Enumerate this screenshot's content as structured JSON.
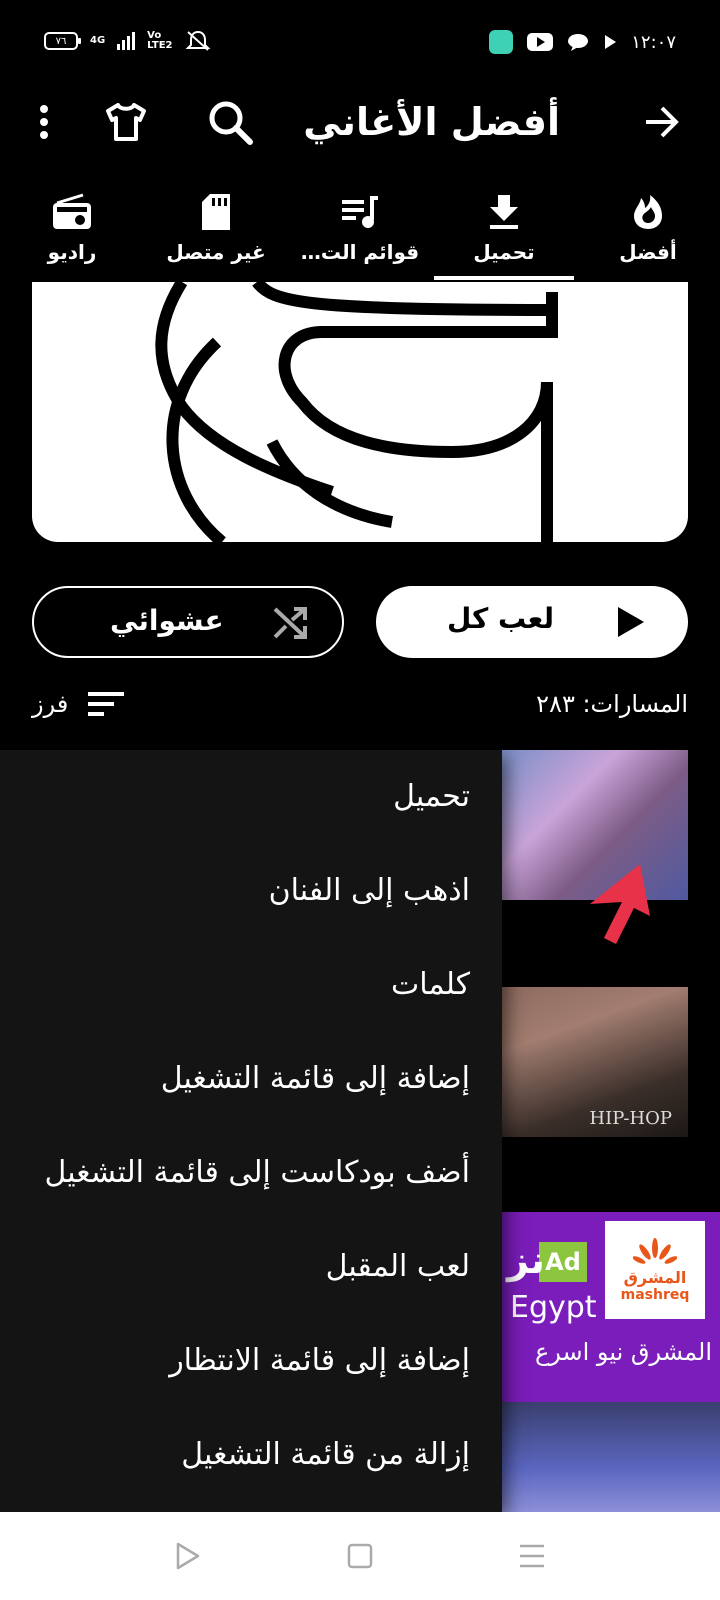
{
  "status_bar": {
    "battery": "٧٦",
    "network": "4G",
    "volte": "Vo LTE2",
    "time": "١٢:٠٧"
  },
  "header": {
    "title": "أفضل الأغاني"
  },
  "tabs": [
    {
      "label": "أفضل",
      "icon": "flame-icon",
      "active": false
    },
    {
      "label": "تحميل",
      "icon": "download-icon",
      "active": true
    },
    {
      "label": "قوائم الت…",
      "icon": "playlist-icon",
      "active": false
    },
    {
      "label": "غير متصل",
      "icon": "sd-card-icon",
      "active": false
    },
    {
      "label": "راديو",
      "icon": "radio-icon",
      "active": false
    }
  ],
  "actions": {
    "play_all": "لعب كل",
    "shuffle": "عشوائي"
  },
  "tracks": {
    "count_label": "المسارات: ٢٨٣",
    "sort_label": "فرز"
  },
  "ad": {
    "badge": "Ad",
    "logo_ar": "المشرق",
    "logo_en": "mashreq",
    "headline_fragment": "نز",
    "country": "Egypt",
    "description": "المشرق نيو اسرع"
  },
  "thumb_label": "HIP-HOP",
  "context_menu": [
    "تحميل",
    "اذهب إلى الفنان",
    "كلمات",
    "إضافة إلى قائمة التشغيل",
    "أضف بودكاست إلى قائمة التشغيل",
    "لعب المقبل",
    "إضافة إلى قائمة الانتظار",
    "إزالة من قائمة التشغيل"
  ],
  "colors": {
    "background": "#000000",
    "menu_background": "#141414",
    "ad_purple": "#7a1dba",
    "ad_green": "#8cc63f",
    "cursor_red": "#e8324a"
  }
}
